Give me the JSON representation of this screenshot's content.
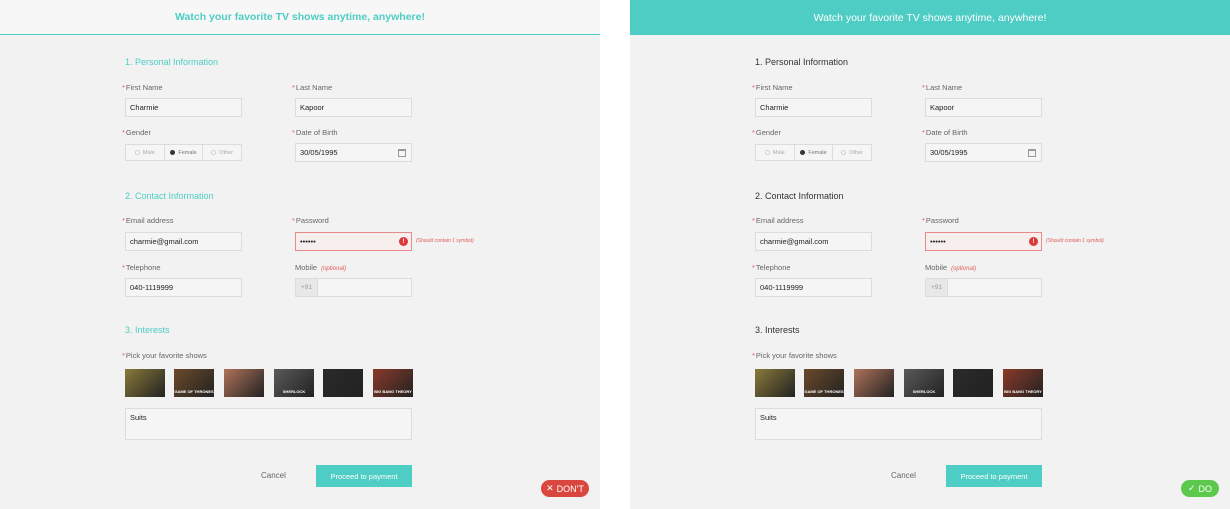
{
  "banner": {
    "text": "Watch your favorite TV shows anytime, anywhere!"
  },
  "personal": {
    "title": "1. Personal Information",
    "first_name_label": "First Name",
    "first_name_value": "Charmie",
    "last_name_label": "Last Name",
    "last_name_value": "Kapoor",
    "gender_label": "Gender",
    "gender_options": [
      "Male",
      "Female",
      "Other"
    ],
    "gender_selected": "Female",
    "dob_label": "Date of Birth",
    "dob_value": "30/05/1995"
  },
  "contact": {
    "title": "2. Contact Information",
    "email_label": "Email address",
    "email_value": "charmie@gmail.com",
    "password_label": "Password",
    "password_value": "••••••",
    "password_error": "(Should contain 1 symbol)",
    "telephone_label": "Telephone",
    "telephone_value": "040-1119999",
    "mobile_label": "Mobile",
    "mobile_optional": "(optional)",
    "mobile_prefix": "+91"
  },
  "interests": {
    "title": "3. Interests",
    "shows_label": "Pick your favorite shows",
    "shows_value": "Suits",
    "thumbnails": [
      {
        "name": "show-1",
        "color": "#8a7a3a",
        "caption": ""
      },
      {
        "name": "game-of-thrones",
        "color": "#6b4a2a",
        "caption": "GAME OF THRONES"
      },
      {
        "name": "friends",
        "color": "#b0735a",
        "caption": ""
      },
      {
        "name": "sherlock",
        "color": "#5a5a5a",
        "caption": "SHERLOCK"
      },
      {
        "name": "house-of-cards",
        "color": "#2a2a2a",
        "caption": ""
      },
      {
        "name": "big-bang-theory",
        "color": "#8b3a2a",
        "caption": "BIG BANG THEORY"
      }
    ]
  },
  "actions": {
    "cancel_label": "Cancel",
    "proceed_label": "Proceed to payment"
  },
  "badges": {
    "dont_label": "DON'T",
    "do_label": "DO"
  },
  "colors": {
    "accent": "#4ecdc4",
    "error": "#d93b3b",
    "dont": "#d9473f",
    "do": "#5cc94d"
  }
}
